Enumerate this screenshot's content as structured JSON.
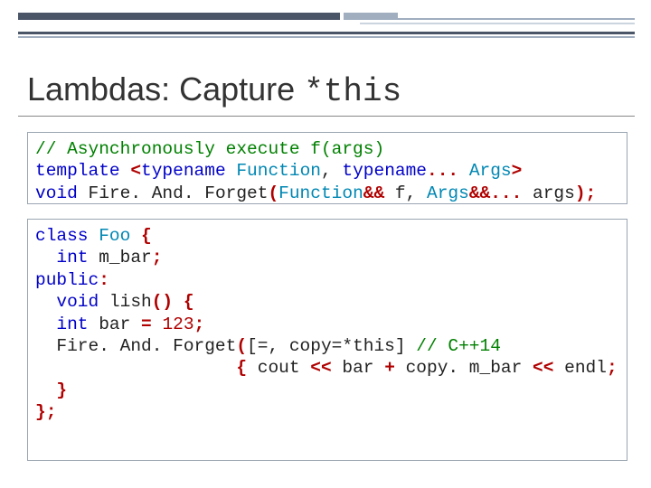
{
  "title": {
    "text": "Lambdas: Capture ",
    "mono": "*this"
  },
  "code1": {
    "l1_comment": "// Asynchronously execute f(args)",
    "l2_kw1": "template ",
    "l2_p1": "<",
    "l2_kw2": "typename ",
    "l2_ty1": "Function",
    "l2_p2": ", ",
    "l2_kw3": "typename",
    "l2_p3": "... ",
    "l2_ty2": "Args",
    "l2_p4": ">",
    "l3_kw1": "void ",
    "l3_fn": "Fire. And. Forget",
    "l3_p1": "(",
    "l3_ty1": "Function",
    "l3_p2": "&& ",
    "l3_a1": "f",
    "l3_p3": ", ",
    "l3_ty2": "Args",
    "l3_p4": "&&... ",
    "l3_a2": "args",
    "l3_p5": ");"
  },
  "code2": {
    "l1_kw": "class ",
    "l1_nm": "Foo ",
    "l1_b": "{",
    "l2_sp": "  ",
    "l2_kw": "int ",
    "l2_nm": "m_bar",
    "l2_sc": ";",
    "l3_kw": "public",
    "l3_c": ":",
    "l4_sp": "  ",
    "l4_kw": "void ",
    "l4_nm": "lish",
    "l4_p": "() {",
    "l5_sp": "  ",
    "l5_kw": "int ",
    "l5_nm": "bar ",
    "l5_eq": "= ",
    "l5_num": "123",
    "l5_sc": ";",
    "l6_sp": "  ",
    "l6_fn": "Fire. And. Forget",
    "l6_p1": "(",
    "l6_cap": "[=, copy=*this] ",
    "l6_cm": "// C++14",
    "l7_sp": "                   ",
    "l7_b1": "{ ",
    "l7_tx": "cout ",
    "l7_op1": "<< ",
    "l7_tx2": "bar ",
    "l7_plus": "+ ",
    "l7_tx3": "copy. m_bar ",
    "l7_op2": "<< ",
    "l7_tx4": "endl",
    "l7_sc": "; });",
    "l8_sp": "  ",
    "l8_b": "}",
    "l9_b": "};"
  }
}
